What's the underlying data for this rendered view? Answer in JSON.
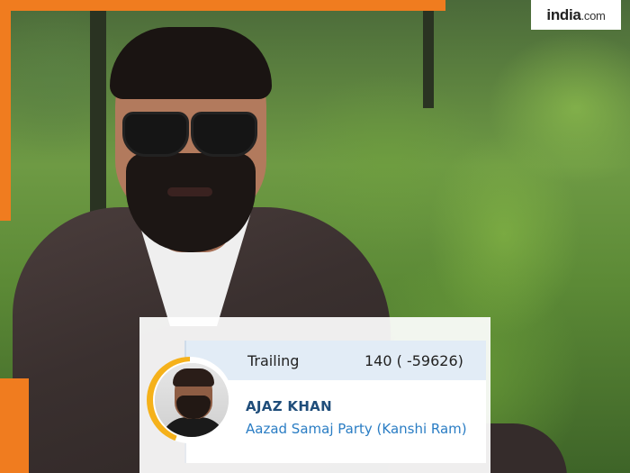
{
  "brand": {
    "logo_main": "india",
    "logo_suffix": ".com",
    "accent_color": "#f07c1f"
  },
  "result_card": {
    "status_label": "Trailing",
    "status_value": "140 ( -59626)",
    "candidate_name": "AJAZ KHAN",
    "party": "Aazad Samaj Party (Kanshi Ram)",
    "name_color": "#1f4d7a",
    "party_color": "#2a7dc4",
    "ring_color": "#f5b11a"
  },
  "icons": {
    "avatar": "candidate-avatar-photo",
    "hero": "hero-photo"
  }
}
